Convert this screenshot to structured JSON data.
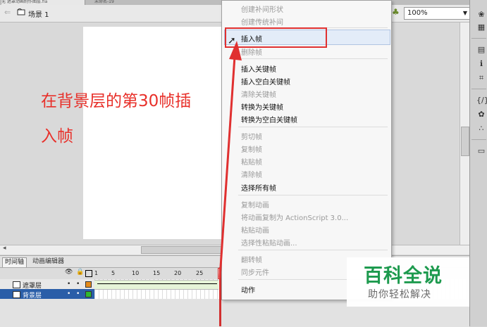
{
  "top_tabs": {
    "tab1": "无 遮罩动画制作图层.fla",
    "tab2": "未命名-19"
  },
  "scene": {
    "label": "场景 1",
    "back_icon": "back-arrow-icon",
    "scene_icon": "scene-icon"
  },
  "zoom": {
    "value": "100%",
    "icon": "zoom-icon"
  },
  "annotation": {
    "line1": "在背景层的第30帧插",
    "line2": "入帧"
  },
  "context_menu": {
    "items": [
      {
        "label": "创建补间形状",
        "enabled": false
      },
      {
        "label": "创建传统补间",
        "enabled": false
      },
      {
        "label": "插入帧",
        "enabled": true,
        "highlighted": true
      },
      {
        "label": "删除帧",
        "enabled": false
      },
      {
        "label": "插入关键帧",
        "enabled": true
      },
      {
        "label": "插入空白关键帧",
        "enabled": true
      },
      {
        "label": "清除关键帧",
        "enabled": false
      },
      {
        "label": "转换为关键帧",
        "enabled": true
      },
      {
        "label": "转换为空白关键帧",
        "enabled": true
      },
      {
        "label": "剪切帧",
        "enabled": false
      },
      {
        "label": "复制帧",
        "enabled": false
      },
      {
        "label": "粘贴帧",
        "enabled": false
      },
      {
        "label": "清除帧",
        "enabled": false
      },
      {
        "label": "选择所有帧",
        "enabled": true
      },
      {
        "label": "复制动画",
        "enabled": false
      },
      {
        "label": "将动画复制为 ActionScript 3.0...",
        "enabled": false
      },
      {
        "label": "粘贴动画",
        "enabled": false
      },
      {
        "label": "选择性粘贴动画...",
        "enabled": false
      },
      {
        "label": "翻转帧",
        "enabled": false
      },
      {
        "label": "同步元件",
        "enabled": false
      },
      {
        "label": "动作",
        "enabled": true
      }
    ]
  },
  "timeline": {
    "tabs": [
      "时间轴",
      "动画编辑器"
    ],
    "ticks": [
      "1",
      "5",
      "10",
      "15",
      "20",
      "25",
      "3"
    ],
    "layers": [
      {
        "name": "遮罩层",
        "visible": "•",
        "locked": "•"
      },
      {
        "name": "背景层",
        "visible": "•",
        "locked": "•"
      }
    ],
    "colors": {
      "mask": "#e38a1a",
      "background": "#2eb82e",
      "selected_row": "#2a5ea8"
    }
  },
  "watermark": {
    "title": "百科全说",
    "subtitle": "助你轻松解决"
  },
  "colors": {
    "annotation": "#e8302a",
    "highlight_box": "#e03030",
    "watermark_green": "#1d9a4e"
  }
}
